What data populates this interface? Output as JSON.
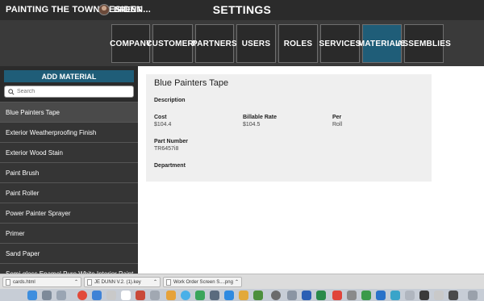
{
  "topbar": {
    "company_name": "PAINTING THE TOWN RESIDEN...",
    "user_name": "BRENT",
    "user_chevron": "⌄",
    "page_title": "SETTINGS"
  },
  "nav": {
    "tabs": [
      {
        "label": "COMPANY",
        "active": false
      },
      {
        "label": "CUSTOMERS",
        "active": false
      },
      {
        "label": "PARTNERS",
        "active": false
      },
      {
        "label": "USERS",
        "active": false
      },
      {
        "label": "ROLES",
        "active": false
      },
      {
        "label": "SERVICES",
        "active": false
      },
      {
        "label": "MATERIALS",
        "active": true
      },
      {
        "label": "ASSEMBLIES",
        "active": false
      }
    ]
  },
  "sidebar": {
    "add_label": "ADD MATERIAL",
    "search_placeholder": "Search",
    "items": [
      "Blue Painters Tape",
      "Exterior Weatherproofing Finish",
      "Exterior Wood Stain",
      "Paint Brush",
      "Paint Roller",
      "Power Painter Sprayer",
      "Primer",
      "Sand Paper",
      "Semi-gloss Enamel Pure White Interior Paint"
    ],
    "selected_index": 0
  },
  "detail": {
    "title": "Blue Painters Tape",
    "description_label": "Description",
    "cost_label": "Cost",
    "cost_value": "$104.4",
    "billable_label": "Billable Rate",
    "billable_value": "$104.5",
    "per_label": "Per",
    "per_value": "Roll",
    "part_label": "Part Number",
    "part_value": "TR6457i8",
    "department_label": "Department"
  },
  "downloads": [
    "cards.html",
    "JE DUNN V.2. (1).key",
    "Work Order Screen S....png"
  ],
  "colors": {
    "accent": "#1f5d78",
    "topbar": "#2b2b2b",
    "nav_bg": "#3a3a3a",
    "sidebar_bg": "#2b2b2b",
    "card_bg": "#efefef"
  }
}
